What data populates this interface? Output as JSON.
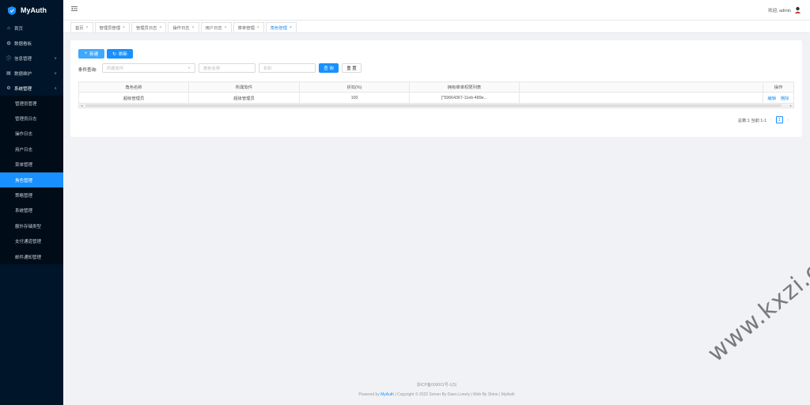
{
  "app": {
    "name": "MyAuth"
  },
  "sidebar": {
    "items": [
      {
        "label": "首页",
        "icon": "home-icon"
      },
      {
        "label": "数据看板",
        "icon": "dashboard-icon"
      },
      {
        "label": "信息管理",
        "icon": "info-icon",
        "arrow": "∨"
      },
      {
        "label": "数据维护",
        "icon": "database-icon",
        "arrow": "∨"
      },
      {
        "label": "系统管理",
        "icon": "gear-icon",
        "arrow": "∧"
      }
    ],
    "sub_items": [
      "管理员管理",
      "管理员日志",
      "操作日志",
      "用户日志",
      "菜单管理",
      "角色管理",
      "策略管理",
      "系统管理",
      "额外存储类型",
      "支付通道管理",
      "邮件通知管理"
    ],
    "active_sub": "角色管理"
  },
  "header": {
    "welcome": "欢迎, admin"
  },
  "tabs": [
    {
      "label": "首页",
      "active": false
    },
    {
      "label": "管理员管理",
      "active": false
    },
    {
      "label": "管理员日志",
      "active": false
    },
    {
      "label": "操作日志",
      "active": false
    },
    {
      "label": "用户日志",
      "active": false
    },
    {
      "label": "菜单管理",
      "active": false
    },
    {
      "label": "角色管理",
      "active": true
    }
  ],
  "toolbar": {
    "new_label": "新建",
    "refresh_label": "刷新"
  },
  "filter": {
    "label": "条件查询:",
    "software_placeholder": "所属软件",
    "name_placeholder": "角色名称",
    "discount_placeholder": "折扣",
    "query_label": "查 询",
    "reset_label": "重 置"
  },
  "table": {
    "columns": [
      "角色名称",
      "所属软件",
      "折扣(%)",
      "拥有菜单权限列表",
      "",
      "操作"
    ],
    "rows": [
      {
        "name": "超级管理员",
        "software": "超级管理员",
        "discount": "100",
        "menus": "[\"59664367-11eb-489e...",
        "extra": "",
        "edit": "编辑",
        "delete": "删除"
      }
    ]
  },
  "pagination": {
    "summary": "总数:1 当前:1-1",
    "current_page": "1",
    "prev": "‹",
    "next": "›"
  },
  "footer": {
    "icp": "浙ICP备000001号-1(5)",
    "powered_prefix": "Powered by ",
    "powered_brand": "MyAuth",
    "powered_suffix": " | Copyright © 2022 Server By Daen.Lonely | Web By Shine | MyAuth"
  },
  "watermark": "www.kxzi.cn",
  "colors": {
    "sidebar_bg": "#001529",
    "accent": "#1890ff",
    "page_bg": "#f0f2f5"
  }
}
